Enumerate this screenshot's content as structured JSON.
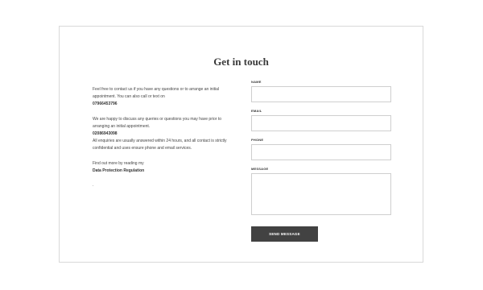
{
  "contact": {
    "title": "Get in touch",
    "intro_line1": "Feel free to contact us if you have any questions or to arrange an initial",
    "intro_line2": "appointment. You can also call  or text  on",
    "phone1": "07966453796",
    "discuss_line1": "We are happy to discuss any queries or questions you may have prior to",
    "discuss_line2": "arranging an initial appointment.",
    "phone2": "02086943098",
    "enquiries_line1": "All enquiries are usually answered within 24 hours, and all contact is strictly",
    "enquiries_line2": "confidential and uses ensure phone and email services.",
    "find_more": "Find out more by reading my",
    "gdpr_link": "Data Protection Regulation",
    "dot": "."
  },
  "form": {
    "name_label": "NAME",
    "email_label": "EMAIL",
    "phone_label": "PHONE",
    "message_label": "MESSAGE",
    "name_value": "",
    "email_value": "",
    "phone_value": "",
    "message_value": "",
    "send_label": "SEND MESSAGE"
  },
  "colors": {
    "button_bg": "#424242",
    "border": "#d9d9d9"
  }
}
